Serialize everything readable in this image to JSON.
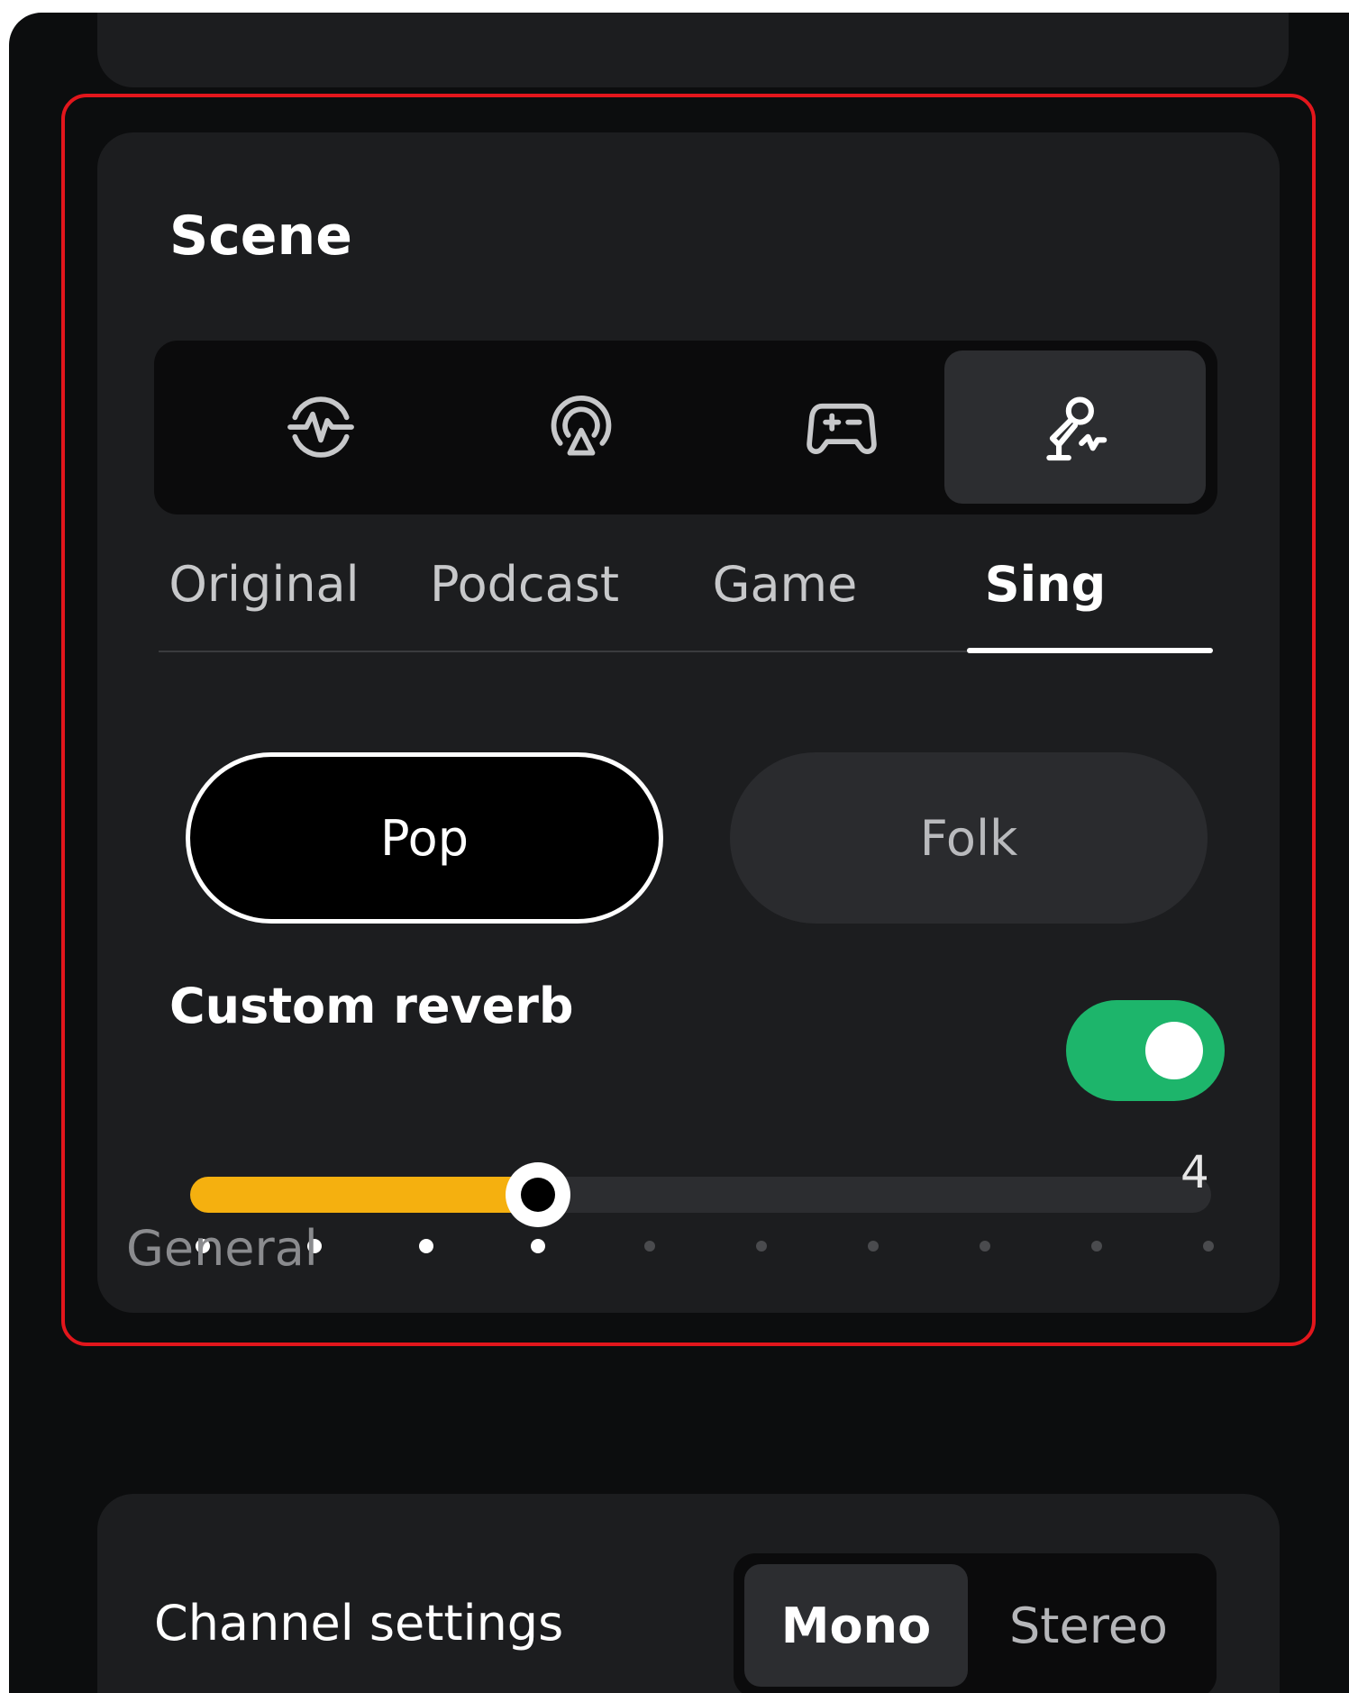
{
  "scene": {
    "title": "Scene",
    "tabs": [
      {
        "label": "Original",
        "icon": "waveform-circle-icon",
        "active": false
      },
      {
        "label": "Podcast",
        "icon": "podcast-broadcast-icon",
        "active": false
      },
      {
        "label": "Game",
        "icon": "gamepad-icon",
        "active": false
      },
      {
        "label": "Sing",
        "icon": "karaoke-microphone-icon",
        "active": true
      }
    ],
    "styles": [
      {
        "label": "Pop",
        "selected": true
      },
      {
        "label": "Folk",
        "selected": false
      }
    ],
    "custom_reverb": {
      "label": "Custom reverb",
      "enabled": true,
      "value": 4,
      "value_label": "4",
      "min": 1,
      "max": 10
    }
  },
  "general": {
    "label": "General",
    "channel_settings": {
      "label": "Channel settings",
      "options": [
        "Mono",
        "Stereo"
      ],
      "selected": "Mono"
    }
  },
  "colors": {
    "accent_toggle": "#1db56b",
    "slider_fill": "#f5b00f",
    "highlight_border": "#e3161c"
  }
}
